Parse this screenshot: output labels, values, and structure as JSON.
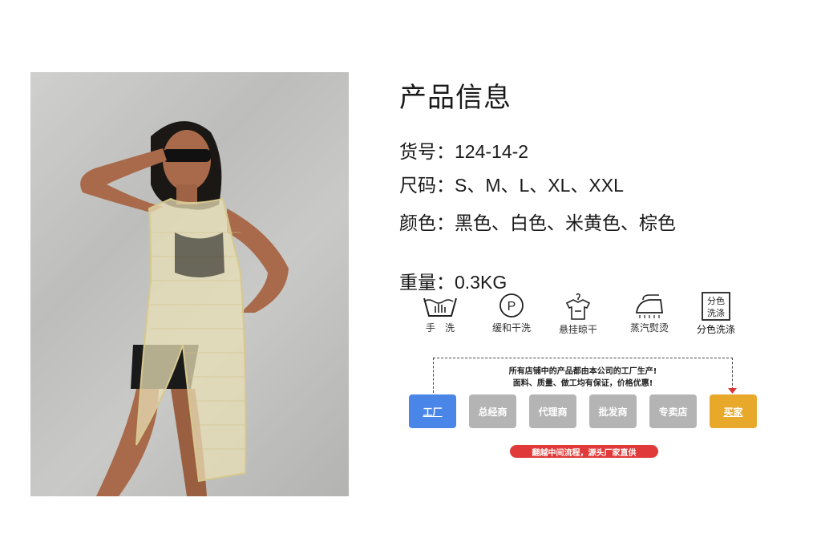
{
  "product": {
    "title": "产品信息",
    "item_no_label": "货号：",
    "item_no": "124-14-2",
    "size_label": "尺码：",
    "sizes": "S、M、L、XL、XXL",
    "color_label": "颜色：",
    "colors": "黑色、白色、米黄色、棕色",
    "weight_label": "重量：",
    "weight": "0.3KG"
  },
  "care": [
    {
      "icon": "hand-wash-icon",
      "label": "手　洗"
    },
    {
      "icon": "dry-clean-icon",
      "label": "缓和干洗"
    },
    {
      "icon": "hang-dry-icon",
      "label": "悬挂晾干"
    },
    {
      "icon": "steam-iron-icon",
      "label": "蒸汽熨烫"
    },
    {
      "icon": "wash-separately-icon",
      "label": "分色洗涤",
      "icon_text_1": "分色",
      "icon_text_2": "洗涤"
    }
  ],
  "supply_chain": {
    "line1": "所有店铺中的产品都由本公司的工厂生产!",
    "line2": "面料、质量、做工均有保证，价格优惠!",
    "steps": [
      "工厂",
      "总经商",
      "代理商",
      "批发商",
      "专卖店",
      "买家"
    ],
    "banner": "翻越中间流程，源头厂家直供"
  },
  "colors": {
    "factory": "#4a86e8",
    "middle": "#b4b4b4",
    "buyer": "#e8a82a",
    "banner": "#e03a3a"
  }
}
